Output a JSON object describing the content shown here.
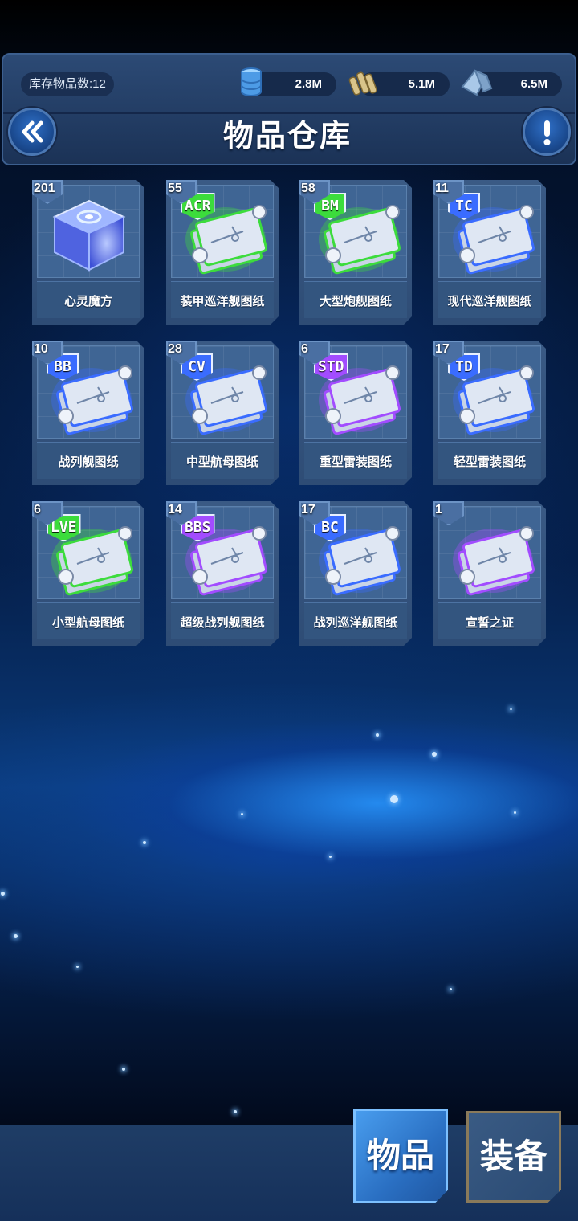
{
  "header": {
    "stock_label": "库存物品数:12",
    "resources": [
      {
        "name": "fuel",
        "icon": "fuel-barrel-icon",
        "value": "2.8M"
      },
      {
        "name": "ammo",
        "icon": "ammo-shells-icon",
        "value": "5.1M"
      },
      {
        "name": "steel",
        "icon": "steel-ingot-icon",
        "value": "6.5M"
      }
    ],
    "title": "物品仓库",
    "back_icon": "double-chevron-left-icon",
    "info_icon": "exclamation-icon"
  },
  "items": [
    {
      "count": "201",
      "name": "心灵魔方",
      "kind": "cube",
      "tag": "",
      "glow": "#6f8fff"
    },
    {
      "count": "55",
      "name": "装甲巡洋舰图纸",
      "kind": "blueprint",
      "tag": "ACR",
      "glow": "#3cdc3c"
    },
    {
      "count": "58",
      "name": "大型炮舰图纸",
      "kind": "blueprint",
      "tag": "BM",
      "glow": "#3cdc3c"
    },
    {
      "count": "11",
      "name": "现代巡洋舰图纸",
      "kind": "blueprint",
      "tag": "TC",
      "glow": "#3a6cff"
    },
    {
      "count": "10",
      "name": "战列舰图纸",
      "kind": "blueprint",
      "tag": "BB",
      "glow": "#3a6cff"
    },
    {
      "count": "28",
      "name": "中型航母图纸",
      "kind": "blueprint",
      "tag": "CV",
      "glow": "#3a6cff"
    },
    {
      "count": "6",
      "name": "重型雷装图纸",
      "kind": "blueprint",
      "tag": "STD",
      "glow": "#a24cff"
    },
    {
      "count": "17",
      "name": "轻型雷装图纸",
      "kind": "blueprint",
      "tag": "TD",
      "glow": "#3a6cff"
    },
    {
      "count": "6",
      "name": "小型航母图纸",
      "kind": "blueprint",
      "tag": "LVE",
      "glow": "#3cdc3c"
    },
    {
      "count": "14",
      "name": "超级战列舰图纸",
      "kind": "blueprint",
      "tag": "BBS",
      "glow": "#a24cff"
    },
    {
      "count": "17",
      "name": "战列巡洋舰图纸",
      "kind": "blueprint",
      "tag": "BC",
      "glow": "#3a6cff"
    },
    {
      "count": "1",
      "name": "宣誓之证",
      "kind": "scroll",
      "tag": "",
      "glow": "#a24cff"
    }
  ],
  "tabs": {
    "items_label": "物品",
    "equipment_label": "装备"
  }
}
